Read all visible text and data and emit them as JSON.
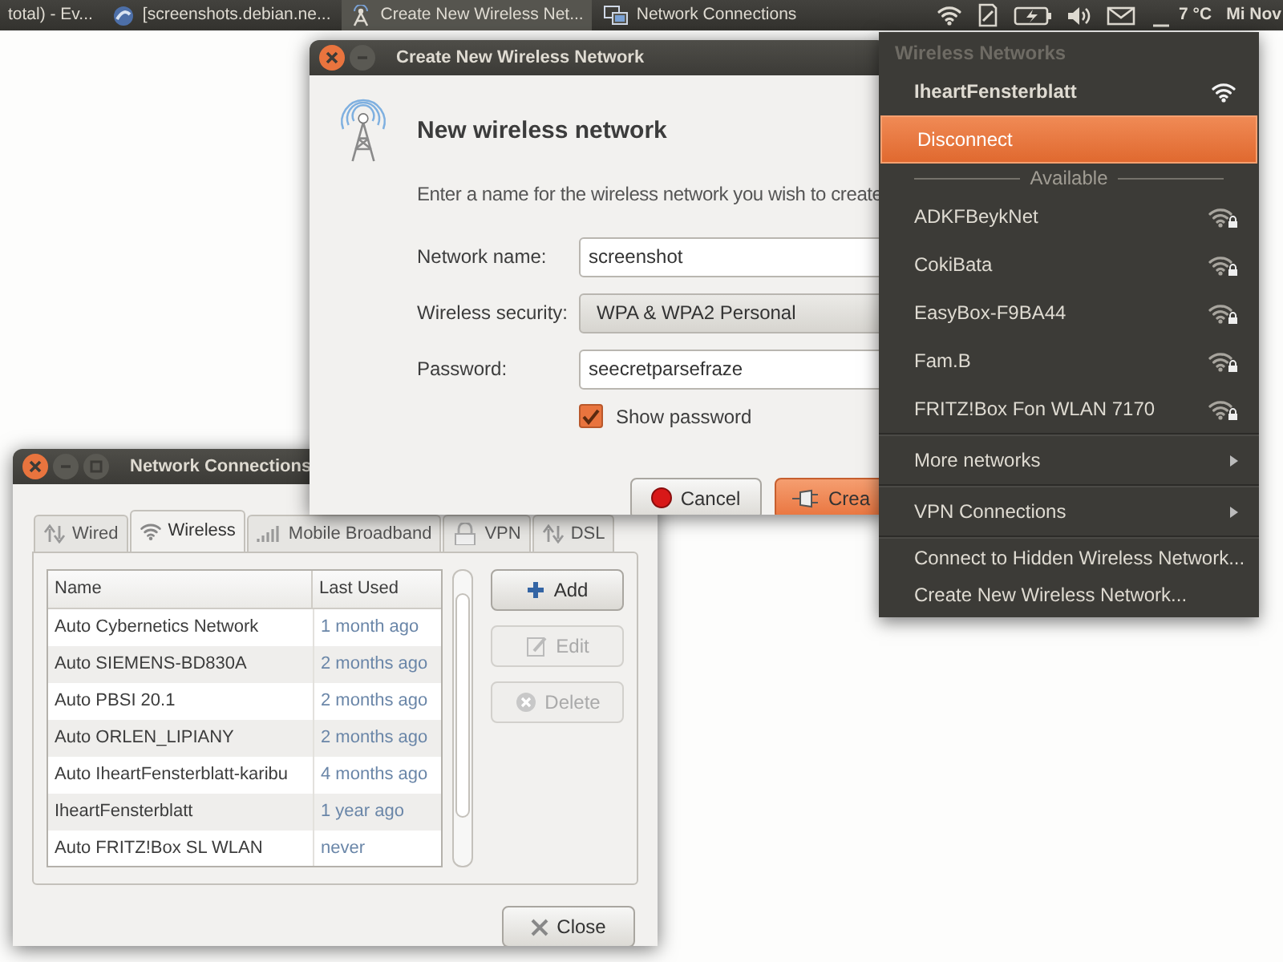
{
  "top_panel": {
    "tasks": [
      {
        "label": "total) - Ev...",
        "selected": false
      },
      {
        "label": "[screenshots.debian.ne...",
        "selected": false
      },
      {
        "label": "Create New Wireless Net...",
        "selected": true
      },
      {
        "label": "Network Connections",
        "selected": false
      }
    ],
    "temperature": "7 °C",
    "clock": "Mi Nov"
  },
  "create_dialog": {
    "title": "Create New Wireless Network",
    "heading": "New wireless network",
    "description": "Enter a name for the wireless network you wish to create",
    "fields": [
      {
        "label": "Network name:",
        "kind": "text",
        "value": "screenshot"
      },
      {
        "label": "Wireless security:",
        "kind": "select",
        "value": "WPA & WPA2 Personal"
      },
      {
        "label": "Password:",
        "kind": "text",
        "value": "seecretparsefraze"
      }
    ],
    "show_password": {
      "label": "Show password",
      "checked": true
    },
    "buttons": [
      {
        "label": "Cancel",
        "kind": "cancel"
      },
      {
        "label": "Crea",
        "kind": "create"
      }
    ]
  },
  "network_connections": {
    "title": "Network Connections",
    "tabs": [
      {
        "label": "Wired",
        "selected": false
      },
      {
        "label": "Wireless",
        "selected": true
      },
      {
        "label": "Mobile Broadband",
        "selected": false
      },
      {
        "label": "VPN",
        "selected": false
      },
      {
        "label": "DSL",
        "selected": false
      }
    ],
    "table": {
      "columns": [
        "Name",
        "Last Used"
      ],
      "rows": [
        {
          "name": "Auto Cybernetics Network",
          "last_used": "1 month ago"
        },
        {
          "name": "Auto SIEMENS-BD830A",
          "last_used": "2 months ago"
        },
        {
          "name": "Auto PBSI 20.1",
          "last_used": "2 months ago"
        },
        {
          "name": "Auto ORLEN_LIPIANY",
          "last_used": "2 months ago"
        },
        {
          "name": "Auto IheartFensterblatt-karibu",
          "last_used": "4 months ago"
        },
        {
          "name": "IheartFensterblatt",
          "last_used": "1 year ago"
        },
        {
          "name": "Auto FRITZ!Box SL WLAN",
          "last_used": "never"
        }
      ]
    },
    "actions": [
      {
        "label": "Add",
        "kind": "add",
        "disabled": false
      },
      {
        "label": "Edit",
        "kind": "edit",
        "disabled": true
      },
      {
        "label": "Delete",
        "kind": "delete",
        "disabled": true
      }
    ],
    "close_button": "Close"
  },
  "wireless_menu": {
    "title": "Wireless Networks",
    "items": [
      {
        "label": "IheartFensterblatt",
        "kind": "connected",
        "selected": false
      },
      {
        "label": "Disconnect",
        "kind": "action",
        "selected": true
      },
      {
        "label": "Available",
        "kind": "section"
      },
      {
        "label": "ADKFBeykNet",
        "kind": "network",
        "selected": false
      },
      {
        "label": "CokiBata",
        "kind": "network",
        "selected": false
      },
      {
        "label": "EasyBox-F9BA44",
        "kind": "network",
        "selected": false
      },
      {
        "label": "Fam.B",
        "kind": "network",
        "selected": false
      },
      {
        "label": "FRITZ!Box Fon WLAN 7170",
        "kind": "network",
        "selected": false
      },
      {
        "label": "More networks",
        "kind": "submenu",
        "selected": false
      },
      {
        "label": "VPN Connections",
        "kind": "submenu",
        "selected": false
      },
      {
        "label": "Connect to Hidden Wireless Network...",
        "kind": "action",
        "selected": false
      },
      {
        "label": "Create New Wireless Network...",
        "kind": "action",
        "selected": false
      }
    ]
  }
}
